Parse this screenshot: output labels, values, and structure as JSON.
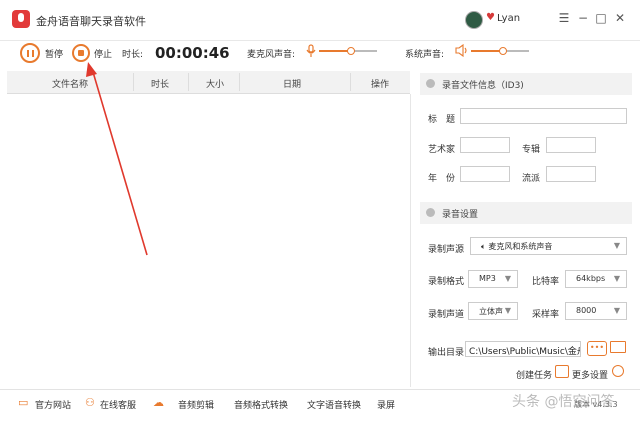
{
  "window": {
    "title": "金舟语音聊天录音软件",
    "username": "Lyan",
    "controls": {
      "menu": "☰",
      "minimize": "−",
      "maximize": "□",
      "close": "✕"
    }
  },
  "toolbar": {
    "pause_label": "暂停",
    "stop_label": "停止",
    "duration_label": "时长:",
    "duration_value": "00:00:46",
    "mic_label": "麦克风声音:",
    "system_label": "系统声音:",
    "mic_level": 0.55,
    "system_level": 0.55
  },
  "table": {
    "columns": [
      "文件名称",
      "时长",
      "大小",
      "日期",
      "操作"
    ]
  },
  "id3": {
    "section_title": "录音文件信息（ID3)",
    "title_label": "标　题",
    "artist_label": "艺术家",
    "album_label": "专辑",
    "year_label": "年　份",
    "genre_label": "流派"
  },
  "settings": {
    "section_title": "录音设置",
    "source_label": "录制声源",
    "source_value": "麦克风和系统声音",
    "format_label": "录制格式",
    "format_value": "MP3",
    "bitrate_label": "比特率",
    "bitrate_value": "64kbps",
    "channel_label": "录制声道",
    "channel_value": "立体声",
    "samplerate_label": "采样率",
    "samplerate_value": "8000",
    "output_label": "输出目录",
    "output_value": "C:\\Users\\Public\\Music\\金舟",
    "dots_label": "•••",
    "create_task_label": "创建任务",
    "more_settings_label": "更多设置"
  },
  "bottombar": {
    "items": [
      "官方网站",
      "在线客服",
      "音频剪辑",
      "音频格式转换",
      "文字语音转换",
      "录屏"
    ],
    "version": "版本 v4.3.3",
    "watermark": "头条 @悟空问答"
  },
  "colors": {
    "accent": "#e87a2e",
    "brand_red": "#e23a3a",
    "annotation": "#e0392d"
  }
}
